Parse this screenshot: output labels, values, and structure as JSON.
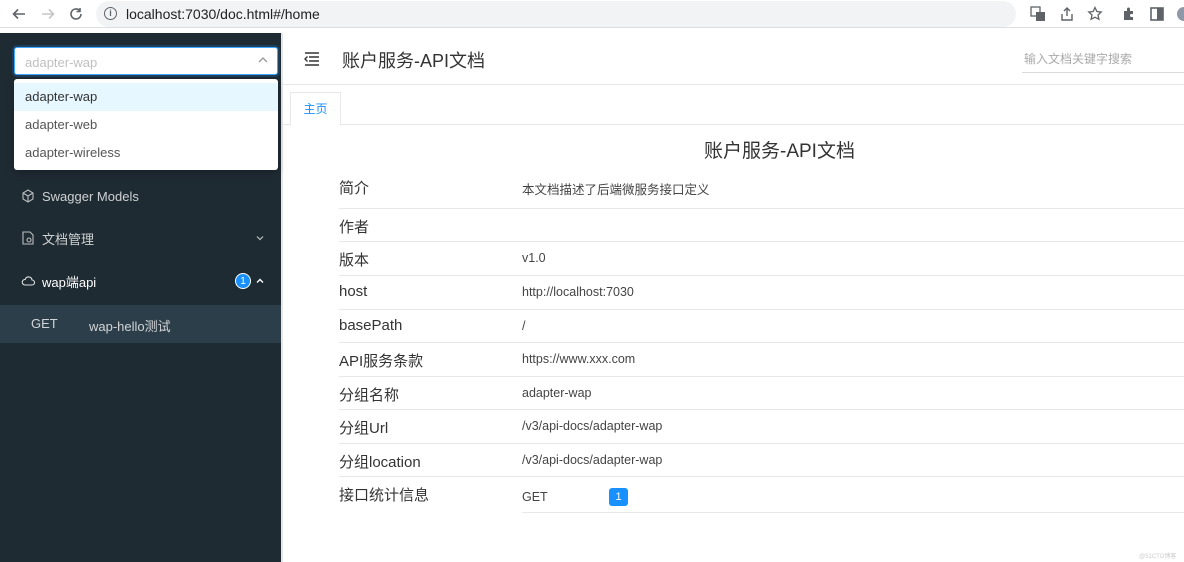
{
  "browser": {
    "url": "localhost:7030/doc.html#/home"
  },
  "sidebar": {
    "group_select": {
      "placeholder": "adapter-wap",
      "options": [
        "adapter-wap",
        "adapter-web",
        "adapter-wireless"
      ],
      "selected": "adapter-wap"
    },
    "menu": [
      {
        "label": "Swagger Models"
      },
      {
        "label": "文档管理"
      },
      {
        "label": "wap端api",
        "badge": "1"
      }
    ],
    "sub_item": {
      "method": "GET",
      "label": "wap-hello测试"
    }
  },
  "header": {
    "title": "账户服务-API文档",
    "search_placeholder": "输入文档关键字搜索"
  },
  "tabs": [
    {
      "label": "主页"
    }
  ],
  "doc": {
    "title": "账户服务-API文档",
    "rows": [
      {
        "label": "简介",
        "value": "本文档描述了后端微服务接口定义"
      },
      {
        "label": "作者",
        "value": ""
      },
      {
        "label": "版本",
        "value": "v1.0"
      },
      {
        "label": "host",
        "value": "http://localhost:7030"
      },
      {
        "label": "basePath",
        "value": "/"
      },
      {
        "label": "API服务条款",
        "value": "https://www.xxx.com"
      },
      {
        "label": "分组名称",
        "value": "adapter-wap"
      },
      {
        "label": "分组Url",
        "value": "/v3/api-docs/adapter-wap"
      },
      {
        "label": "分组location",
        "value": "/v3/api-docs/adapter-wap"
      },
      {
        "label": "接口统计信息",
        "value": ""
      }
    ],
    "stats": {
      "method": "GET",
      "count": "1"
    }
  },
  "watermark": "@51CTO博客"
}
